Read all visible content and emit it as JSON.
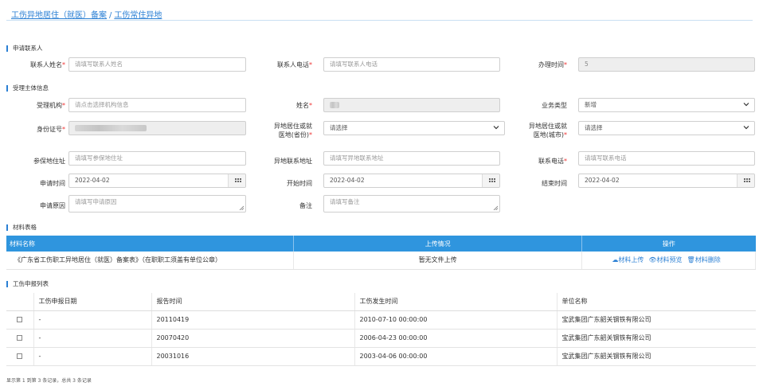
{
  "breadcrumb": {
    "part1": "工伤异地居住（就医）备案",
    "sep": "/",
    "part2": "工伤常住异地"
  },
  "sections": {
    "applicant": "申请联系人",
    "subject": "受理主体信息",
    "materials": "材料表格",
    "reports": "工伤申报列表"
  },
  "form": {
    "contact_name": {
      "label": "联系人姓名",
      "placeholder": "请填写联系人姓名"
    },
    "contact_phone": {
      "label": "联系人电话",
      "placeholder": "请填写联系人电话"
    },
    "handle_time": {
      "label": "办理时间",
      "value": "5"
    },
    "agency": {
      "label": "受理机构",
      "placeholder": "请点击选择机构信息"
    },
    "name": {
      "label": "姓名"
    },
    "biz_type": {
      "label": "业务类型",
      "value": "新增"
    },
    "id_no": {
      "label": "身份证号"
    },
    "province": {
      "label1": "异地居住或就",
      "label2": "医地(省份)",
      "value": "请选择"
    },
    "city": {
      "label1": "异地居住或就",
      "label2": "医地(城市)",
      "value": "请选择"
    },
    "insured_addr": {
      "label": "参保地住址",
      "placeholder": "请填写参保地住址"
    },
    "remote_addr": {
      "label": "异地联系地址",
      "placeholder": "请填写异地联系地址"
    },
    "phone": {
      "label": "联系电话",
      "placeholder": "请填写联系电话"
    },
    "apply_time": {
      "label": "申请时间",
      "value": "2022-04-02"
    },
    "start_time": {
      "label": "开始时间",
      "value": "2022-04-02"
    },
    "end_time": {
      "label": "结束时间",
      "value": "2022-04-02"
    },
    "reason": {
      "label": "申请原因",
      "placeholder": "请填写申请原因"
    },
    "remark": {
      "label": "备注",
      "placeholder": "请填写备注"
    }
  },
  "materials": {
    "headers": [
      "材料名称",
      "上传情况",
      "操作"
    ],
    "row": {
      "name": "《广东省工伤职工异地居住（就医）备案表》（在职职工须盖有单位公章）",
      "status": "暂无文件上传",
      "upload": "材料上传",
      "preview": "材料预览",
      "delete": "材料删除"
    }
  },
  "reports": {
    "headers": [
      "工伤申报日期",
      "报告时间",
      "工伤发生时间",
      "单位名称"
    ],
    "rows": [
      {
        "date": "-",
        "report": "20110419",
        "occur": "2010-07-10 00:00:00",
        "unit": "宝武集团广东韶关钢铁有限公司"
      },
      {
        "date": "-",
        "report": "20070420",
        "occur": "2006-04-23 00:00:00",
        "unit": "宝武集团广东韶关钢铁有限公司"
      },
      {
        "date": "-",
        "report": "20031016",
        "occur": "2003-04-06 00:00:00",
        "unit": "宝武集团广东韶关钢铁有限公司"
      }
    ]
  },
  "pager": {
    "text": "显示第 1 到第 3 条记录，总共 3 条记录"
  },
  "colors": {
    "accent": "#2f95de",
    "link": "#2a7fd4",
    "required": "#e33333"
  }
}
